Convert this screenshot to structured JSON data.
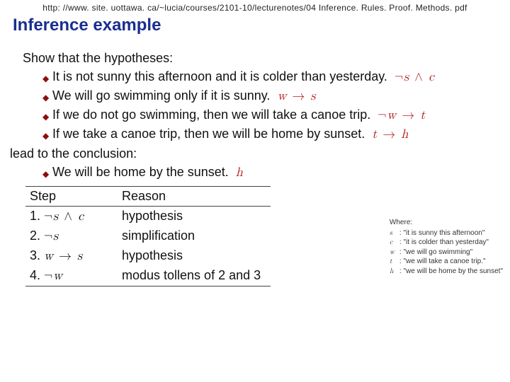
{
  "url": "http: //www. site. uottawa. ca/~lucia/courses/2101-10/lecturenotes/04 Inference. Rules. Proof. Methods. pdf",
  "title": "Inference example",
  "lead1": "Show that the hypotheses:",
  "hyp": [
    {
      "text": "It is not sunny this afternoon and it is colder than yesterday.",
      "formula_html": "<span class='neg'>¬</span>s <span class='op'>∧</span> c"
    },
    {
      "text": "We will go swimming only if it is sunny.",
      "formula_html": "w <span class='op'>→</span> s"
    },
    {
      "text": "If we do not go swimming, then we will take a canoe trip.",
      "formula_html": "<span class='neg'>¬</span>w <span class='op'>→</span> t"
    },
    {
      "text": "If we take a canoe trip, then we will be home by sunset.",
      "formula_html": "t <span class='op'>→</span> h"
    }
  ],
  "lead2": "lead to the conclusion:",
  "conclusion": {
    "text": "We will be home by the sunset.",
    "formula_html": "h"
  },
  "table": {
    "headers": [
      "Step",
      "Reason"
    ],
    "rows": [
      {
        "n": "1.",
        "step_html": "<span class='neg'>¬</span>s <span class='op'>∧</span> c",
        "reason": "hypothesis"
      },
      {
        "n": "2.",
        "step_html": "<span class='neg'>¬</span>s",
        "reason": "simplification"
      },
      {
        "n": "3.",
        "step_html": "w <span class='op'>→</span> s",
        "reason": "hypothesis"
      },
      {
        "n": "4.",
        "step_html": "<span class='neg'>¬</span>w",
        "reason": "modus tollens of 2 and 3"
      }
    ]
  },
  "legend": {
    "title": "Where:",
    "items": [
      {
        "v": "s",
        "d": "\"it is sunny this afternoon\""
      },
      {
        "v": "c",
        "d": "\"it is colder than yesterday\""
      },
      {
        "v": "w",
        "d": "\"we will go swimming\""
      },
      {
        "v": "t",
        "d": "\"we will take a canoe trip.\""
      },
      {
        "v": "h",
        "d": "\"we will be home by the sunset\""
      }
    ]
  }
}
